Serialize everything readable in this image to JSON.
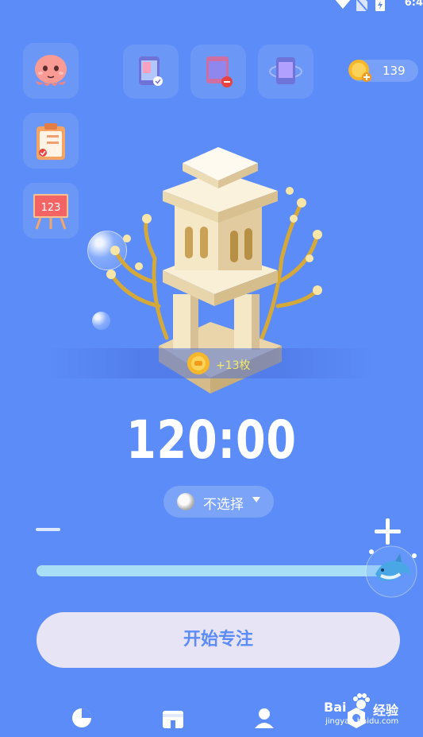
{
  "status_bar": {
    "time": "6:4",
    "icons": [
      "wifi-icon",
      "no-sim-icon",
      "battery-charging-icon"
    ]
  },
  "side_menu": [
    {
      "name": "octopus-avatar-icon"
    },
    {
      "name": "task-list-icon"
    },
    {
      "name": "counter-board-icon"
    }
  ],
  "top_toolbar": [
    {
      "name": "phone-whitelist-icon"
    },
    {
      "name": "phone-block-icon"
    },
    {
      "name": "phone-rotate-icon"
    }
  ],
  "coins": {
    "count": "139"
  },
  "reward": {
    "text": "+13枚"
  },
  "timer": {
    "value": "120:00"
  },
  "tag": {
    "label": "不选择"
  },
  "slider": {
    "level": 1.0
  },
  "start_button": {
    "label": "开始专注"
  },
  "nav": [
    "stats-icon",
    "shop-icon",
    "profile-icon",
    "settings-icon"
  ],
  "watermark": {
    "brand": "Bai",
    "text": "经验",
    "url": "jingyan.baidu.com"
  },
  "colors": {
    "background": "#5b8cf7",
    "button": "#e7e4f6",
    "slider": "#a9dff6",
    "reward_text": "#f3ea6b"
  }
}
